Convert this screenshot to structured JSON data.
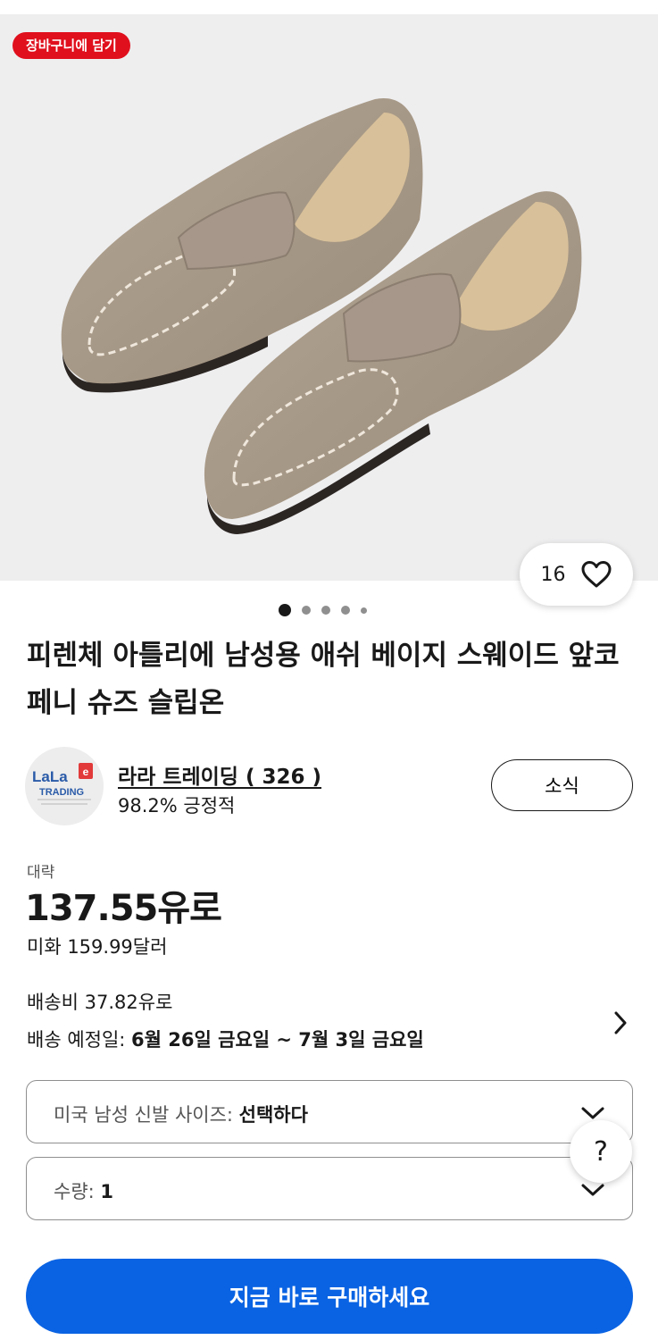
{
  "gallery": {
    "cart_badge": "장바구니에 담기",
    "watch_count": "16",
    "image_count": 5,
    "active_image_index": 1
  },
  "product": {
    "title": "피렌체 아틀리에 남성용 애쉬 베이지 스웨이드 앞코 페니 슈즈 슬립온"
  },
  "seller": {
    "logo_text": "LaLa e TRADING",
    "name": "라라 트레이딩 ( 326 )",
    "feedback": "98.2% 긍정적",
    "follow_label": "소식"
  },
  "pricing": {
    "approx_label": "대략",
    "price": "137.55유로",
    "usd_price": "미화 159.99달러"
  },
  "shipping": {
    "cost": "배송비 37.82유로",
    "date_label": "배송 예정일: ",
    "date_value": "6월 26일 금요일 ~ 7월 3일 금요일"
  },
  "options": {
    "size_label": "미국 남성 신발 사이즈: ",
    "size_value": "선택하다",
    "qty_label": "수량: ",
    "qty_value": "1"
  },
  "help_label": "?",
  "buy_button": "지금 바로 구매하세요",
  "colors": {
    "cart_badge": "#e0101d",
    "buy_button": "#0a63e3",
    "gallery_bg": "#eeeeef",
    "shoe_suede": "#a89a88"
  }
}
